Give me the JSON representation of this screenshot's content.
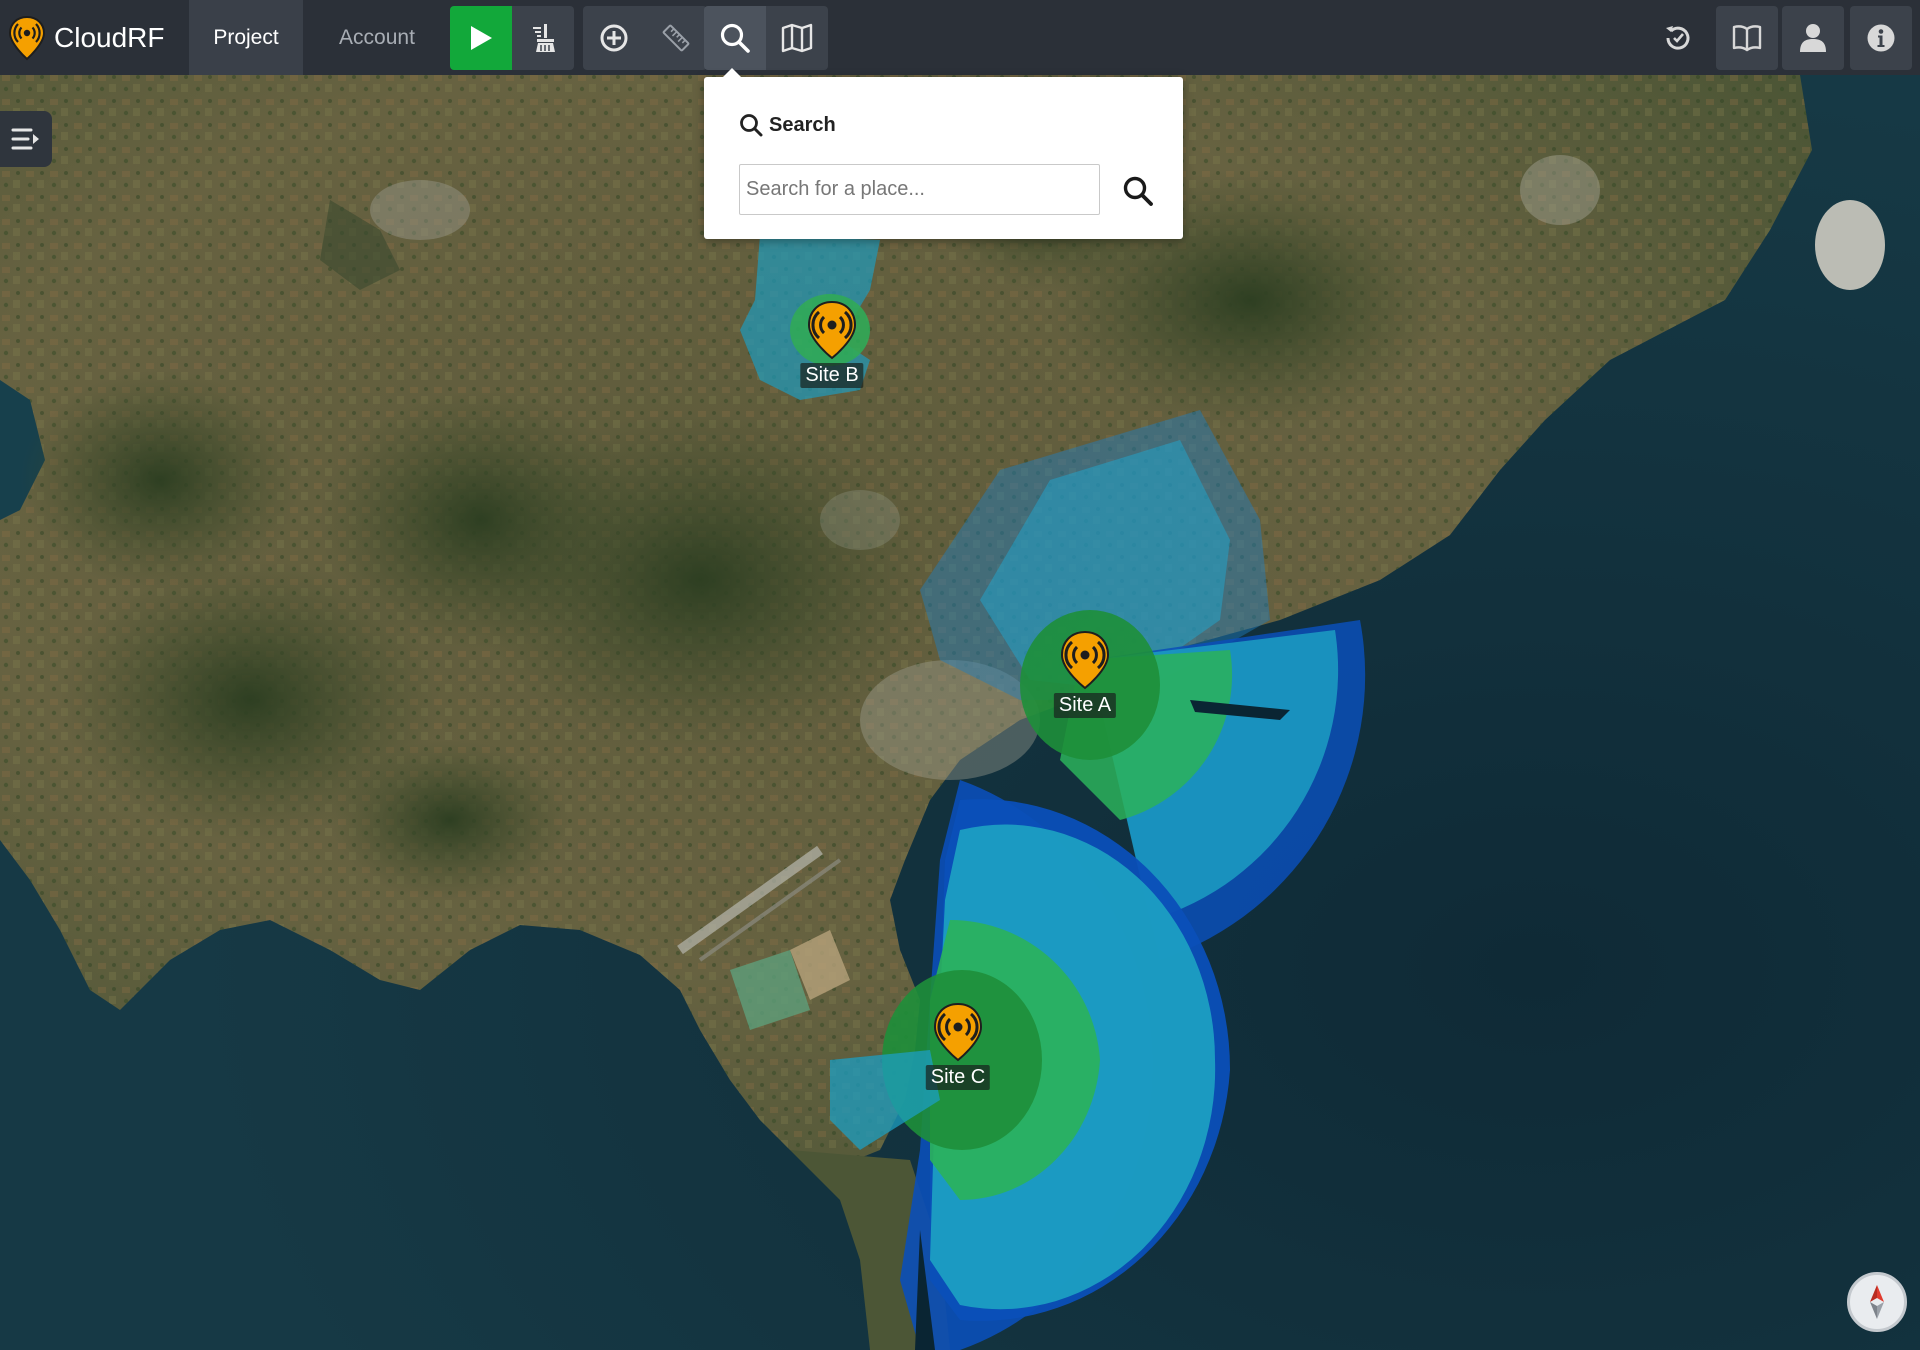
{
  "app": {
    "name": "CloudRF",
    "logo_icon": "cloudrf-logo-icon",
    "brand_color": "#f5a000"
  },
  "nav": {
    "tabs": [
      {
        "label": "Project",
        "active": true
      },
      {
        "label": "Account",
        "active": false
      }
    ]
  },
  "toolbar": {
    "groups": [
      {
        "buttons": [
          {
            "icon": "play-icon",
            "name": "run-button",
            "color": "#12a83a"
          },
          {
            "icon": "broom-clear-icon",
            "name": "clear-button"
          }
        ]
      },
      {
        "buttons": [
          {
            "icon": "add-circle-icon",
            "name": "add-site-button"
          },
          {
            "icon": "ruler-icon",
            "name": "measure-button"
          }
        ]
      },
      {
        "buttons": [
          {
            "icon": "search-icon",
            "name": "search-button",
            "active": true
          },
          {
            "icon": "map-layers-icon",
            "name": "map-layers-button"
          }
        ]
      }
    ],
    "right_buttons": [
      {
        "icon": "history-icon",
        "name": "history-button"
      },
      {
        "icon": "book-icon",
        "name": "docs-button"
      },
      {
        "icon": "user-icon",
        "name": "user-button"
      },
      {
        "icon": "info-icon",
        "name": "info-button"
      }
    ]
  },
  "search": {
    "title": "Search",
    "placeholder": "Search for a place...",
    "value": ""
  },
  "sites": [
    {
      "label": "Site A"
    },
    {
      "label": "Site B"
    },
    {
      "label": "Site C"
    }
  ],
  "map": {
    "sea_color": "#12303b",
    "land_color": "#5b5e3c",
    "coverage_colors": [
      "#1e8f3a",
      "#2bb25a",
      "#1c9ec2",
      "#0f6fbf",
      "#0b4fb8"
    ]
  }
}
